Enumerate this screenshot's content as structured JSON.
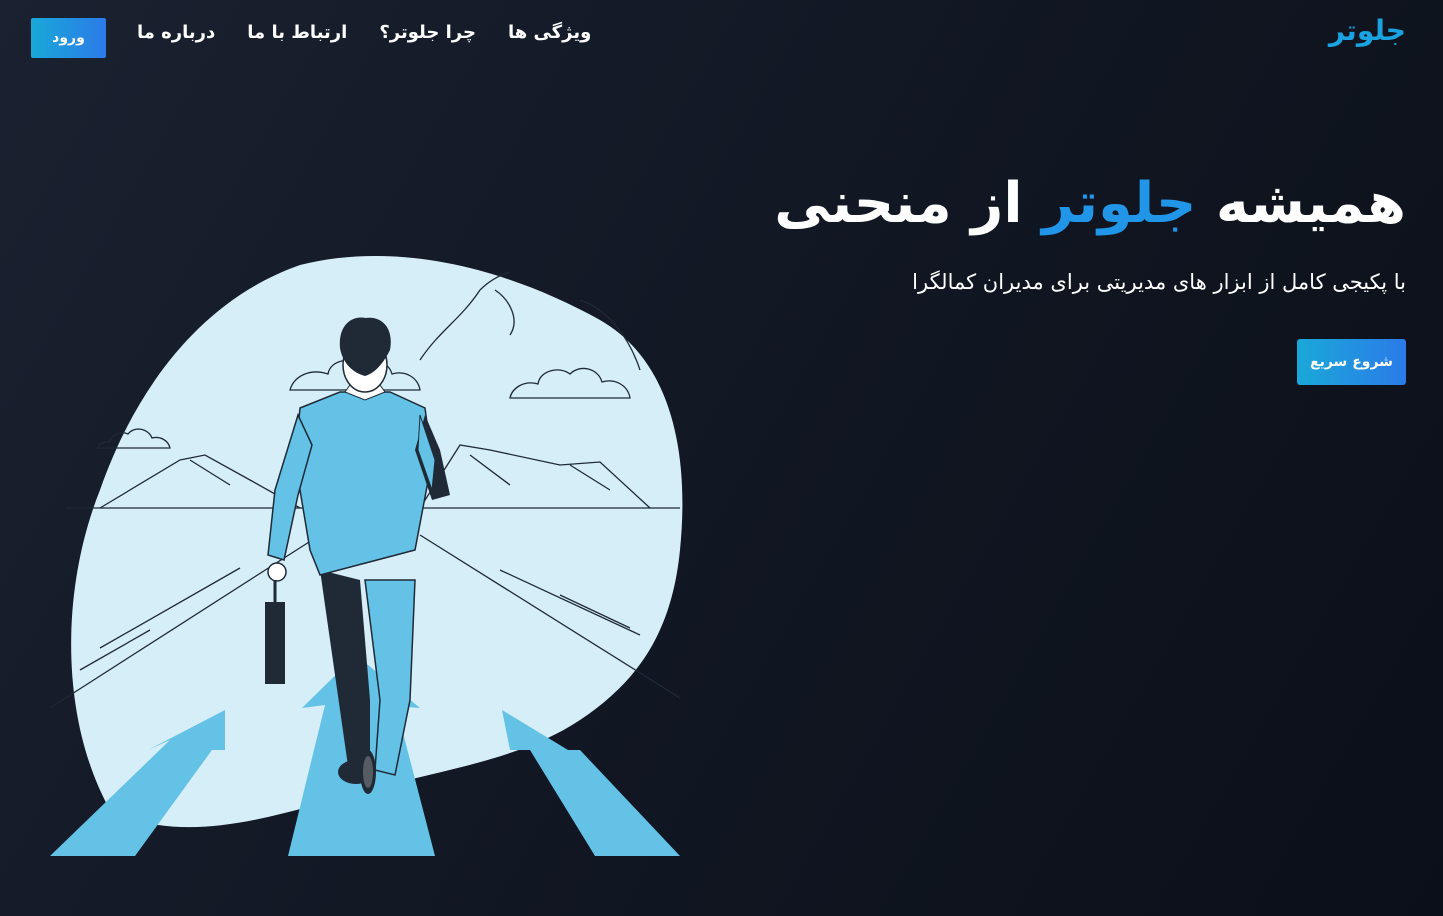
{
  "nav": {
    "brand": "جلوتر",
    "links": [
      "ویژگی ها",
      "چرا جلوتر؟",
      "ارتباط با ما",
      "درباره ما"
    ],
    "login_label": "ورود"
  },
  "hero": {
    "title_part1": "همیشه ",
    "title_accent": "جلوتر",
    "title_part2": " از منحنی",
    "subtitle": "با پکیجی کامل از ابزار های مدیریتی برای مدیران کمالگرا",
    "cta_label": "شروع سریع"
  },
  "colors": {
    "accent": "#2196e8",
    "brand": "#1aa3e0",
    "background": "#121824",
    "illustration_bg": "#d6eef8",
    "suit": "#63c2e6"
  }
}
